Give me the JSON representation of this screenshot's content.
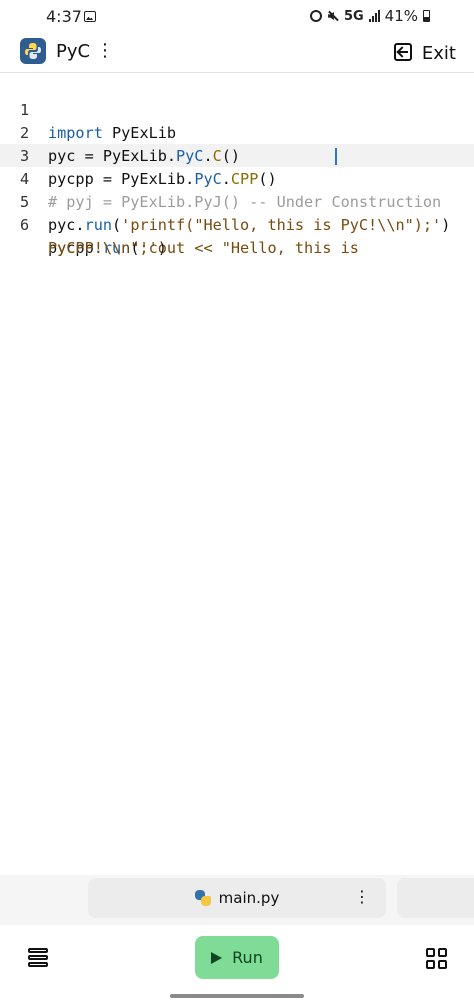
{
  "status_bar": {
    "time": "4:37",
    "network": "5G",
    "battery": "41%"
  },
  "app_bar": {
    "title": "PyC",
    "more": "⋮",
    "exit_label": "Exit"
  },
  "editor": {
    "line_numbers": [
      "1",
      "2",
      "3",
      "4",
      "5",
      "6"
    ],
    "lines": [
      [
        "import",
        " PyExLib"
      ],
      [
        "pyc = PyExLib.",
        "PyC",
        ".",
        "C",
        "()"
      ],
      [
        "pycpp = PyExLib.",
        "PyC",
        ".",
        "CPP",
        "()"
      ],
      [
        "# pyj = PyExLib.PyJ() -- Under Construction"
      ],
      [
        "pyc.",
        "run",
        "(",
        "'printf(\"Hello, this is PyC!\\\\n\");'",
        ")"
      ],
      [
        "pycpp.",
        "run",
        "(",
        "'cout << \"Hello, this is"
      ]
    ],
    "line_6_wrap": [
      "PyCPP!\\\\n\";'",
      ")"
    ]
  },
  "file_tab": {
    "name": "main.py",
    "more": "⋮"
  },
  "bottom_bar": {
    "run_label": "Run"
  },
  "colors": {
    "keyword": "#1a5fa6",
    "string": "#7a4a0f",
    "comment": "#9c9c9c",
    "run_button": "#7fdc97",
    "caret": "#2a76d2"
  },
  "icons": [
    "photo-icon",
    "alarm-icon",
    "mute-icon",
    "signal-icon",
    "battery-icon",
    "python-logo-icon",
    "more-vertical-icon",
    "exit-icon",
    "files-icon",
    "play-icon",
    "grid-icon"
  ]
}
